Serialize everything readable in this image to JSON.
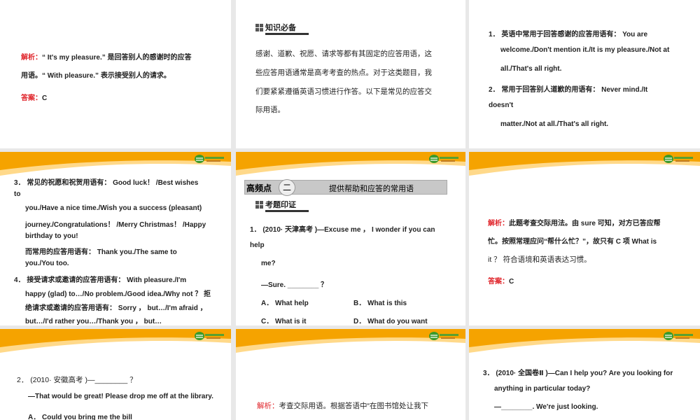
{
  "slides": [
    {
      "id": "r1c1",
      "lines": [
        {
          "label": "解析：",
          "text": "“ It's my pleasure.” 是回答别人的感谢时的应答"
        },
        {
          "text": "用语。“ With pleasure.” 表示接受别人的请求。"
        },
        {
          "label": "答案：",
          "text": "C"
        }
      ]
    },
    {
      "id": "r1c2",
      "tag": "知识必备",
      "lines": [
        {
          "text": "感谢、道歉、祝愿、请求等都有其固定的应答用语，这"
        },
        {
          "text": "些应答用语通常是高考考查的热点。对于这类题目，我"
        },
        {
          "text": "们要紧紧遵循英语习惯进行作答。以下是常见的应答交"
        },
        {
          "text": "际用语。"
        }
      ]
    },
    {
      "id": "r1c3",
      "lines": [
        {
          "text": "1． 英语中常用于回答感谢的应答用语有：  You are"
        },
        {
          "text": "welcome./Don't mention it./It is my pleasure./Not at"
        },
        {
          "text": "all./That's all right."
        },
        {
          "text": "2． 常用于回答别人道歉的用语有：  Never mind./It"
        },
        {
          "text": "doesn't"
        },
        {
          "text": "matter./Not at all./That's all right."
        }
      ]
    },
    {
      "id": "r2c1",
      "lines": [
        {
          "text": "3． 常见的祝愿和祝贺用语有：  Good luck！  /Best wishes"
        },
        {
          "text": "to"
        },
        {
          "text": "you./Have a nice time./Wish you a success (pleasant)"
        },
        {
          "text": "journey./Congratulations！  /Merry Christmas！  /Happy"
        },
        {
          "text": "birthday to you!"
        },
        {
          "text": "而常用的应答用语有：  Thank you./The same to"
        },
        {
          "text": "you./You too."
        },
        {
          "text": "4． 接受请求或邀请的应答用语有：  With pleasure./I'm"
        },
        {
          "text": "happy (glad) to…/No problem./Good idea./Why not ？ 拒"
        },
        {
          "text": "绝请求或邀请的应答用语有：  Sorry ，  but…/I'm afraid ，"
        },
        {
          "text": "but…/I'd rather you…/Thank you ，  but…"
        }
      ]
    },
    {
      "id": "r2c2",
      "section": {
        "label": "高频点",
        "num": "二",
        "title": "提供帮助和应答的常用语"
      },
      "tag": "考题印证",
      "lines": [
        {
          "text": "1． (2010· 天津高考 )—Excuse me ，  I wonder if you can"
        },
        {
          "text": "help"
        },
        {
          "text": "me?"
        },
        {
          "text": "—Sure. ________ ？"
        },
        {
          "text": "A． What help",
          "text2": "B． What is this"
        },
        {
          "text": "C． What is it",
          "text2": "D． What do you want"
        }
      ]
    },
    {
      "id": "r2c3",
      "lines": [
        {
          "label": "解析：",
          "text": "此题考查交际用法。由 sure 可知，对方已答应帮"
        },
        {
          "text": "忙。按照常理应问“帮什么忙？”，故只有 C 项 What is"
        },
        {
          "text": "it ？ 符合语境和英语表达习惯。"
        },
        {
          "label": "答案：",
          "text": "C"
        }
      ]
    },
    {
      "id": "r3c1",
      "lines": [
        {
          "text": "2． (2010· 安徽高考 )—________ ？"
        },
        {
          "text": "—That would be great! Please drop me off at the library."
        },
        {
          "text": "A． Could you bring me the bill"
        }
      ]
    },
    {
      "id": "r3c2",
      "lines": [
        {
          "label": "解析：",
          "text": "考查交际用语。根据答语中“在图书馆处让我下"
        }
      ]
    },
    {
      "id": "r3c3",
      "lines": [
        {
          "text": "3． (2010· 全国卷Ⅱ )—Can I help you? Are you looking for"
        },
        {
          "text": "anything in particular today?"
        },
        {
          "text": "—________. We're just looking."
        }
      ]
    }
  ],
  "colors": {
    "header": "#f5a300",
    "label": "#e0262c"
  }
}
